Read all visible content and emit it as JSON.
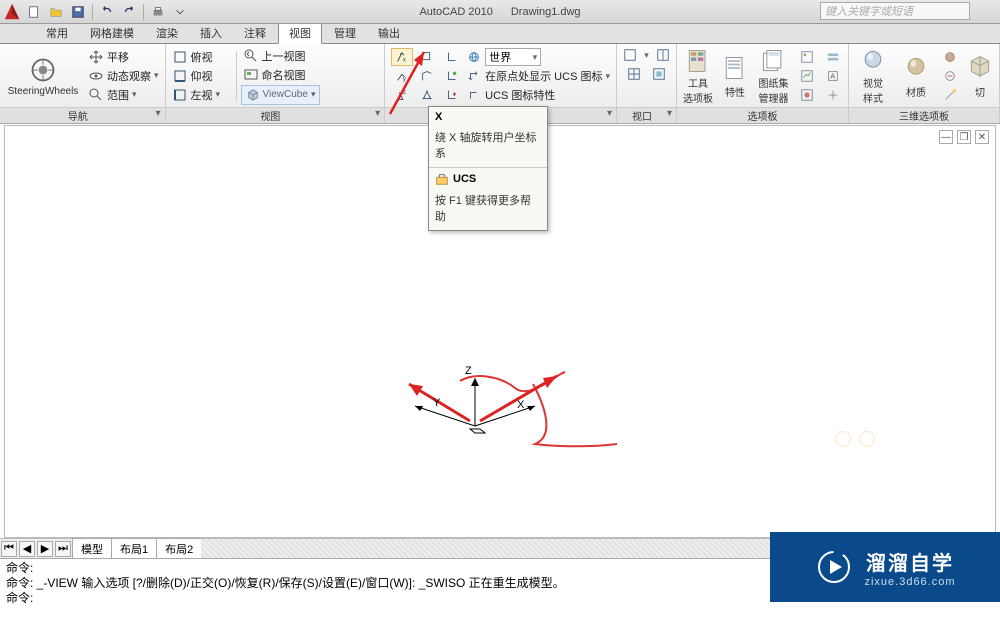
{
  "title": {
    "app": "AutoCAD 2010",
    "doc": "Drawing1.dwg"
  },
  "search": {
    "placeholder": "键入关键字或短语"
  },
  "tabs": [
    "常用",
    "网格建模",
    "渲染",
    "插入",
    "注释",
    "视图",
    "管理",
    "输出"
  ],
  "tabs_active_index": 5,
  "ribbon": {
    "nav": {
      "title": "导航",
      "main": "SteeringWheels",
      "rows": [
        "平移",
        "动态观察",
        "范围"
      ]
    },
    "view": {
      "title": "视图",
      "col1": [
        "俯视",
        "仰视",
        "左视"
      ],
      "col2": [
        "上一视图",
        "命名视图",
        "ViewCube"
      ]
    },
    "ucs_panel": {
      "world_combo": "世界",
      "show_ucs": "在原点处显示 UCS 图标",
      "ucs_props": "UCS 图标特性"
    },
    "viewport": {
      "title": "视口"
    },
    "palette": {
      "title": "选项板",
      "tool": "工具\n选项板",
      "props": "特性",
      "sheet": "图纸集\n管理器"
    },
    "viz3d": {
      "title": "三维选项板",
      "style": "视觉\n样式",
      "material": "材质",
      "other": "切"
    }
  },
  "tooltip": {
    "title": "X",
    "desc": "绕 X 轴旋转用户坐标系",
    "ucs_label": "UCS",
    "help": "按 F1 键获得更多帮助"
  },
  "canvas": {
    "axes": {
      "x": "X",
      "y": "Y",
      "z": "Z"
    }
  },
  "model_tabs": [
    "模型",
    "布局1",
    "布局2"
  ],
  "commands": {
    "l1": "命令:",
    "l2": "命令: _-VIEW 输入选项 [?/删除(D)/正交(O)/恢复(R)/保存(S)/设置(E)/窗口(W)]: _SWISO 正在重生成模型。",
    "l3": "命令:"
  },
  "watermark": {
    "cn": "溜溜自学",
    "en": "zixue.3d66.com"
  }
}
